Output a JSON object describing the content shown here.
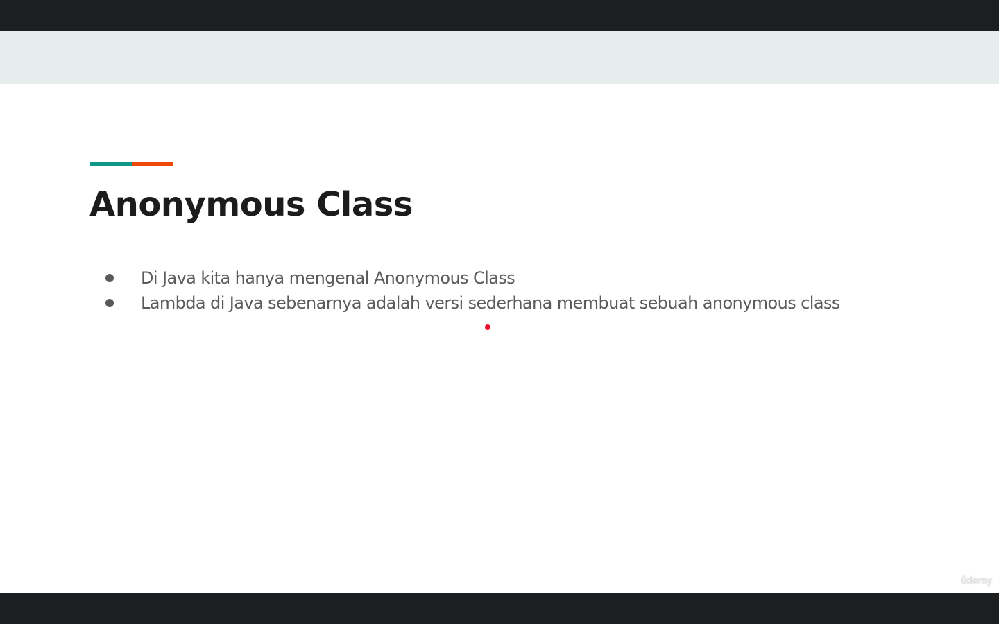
{
  "slide": {
    "title": "Anonymous Class",
    "bullets": [
      "Di Java kita hanya mengenal Anonymous Class",
      "Lambda di Java sebenarnya adalah versi sederhana membuat sebuah anonymous class"
    ]
  },
  "watermark": {
    "text": "ûdemy"
  },
  "colors": {
    "frame": "#1d1e20",
    "header_band": "#e7ecec",
    "accent_teal": "#0e9a8a",
    "accent_orange": "#f04a0a",
    "title": "#1c1c1c",
    "body_text": "#5b5b5b",
    "pointer": "#e8102e"
  }
}
